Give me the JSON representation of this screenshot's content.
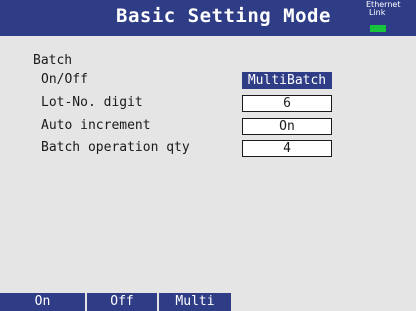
{
  "header": {
    "title": "Basic Setting Mode",
    "ethernet_label": "Ethernet",
    "link_label": "Link",
    "link_led_color": "#18c43c"
  },
  "section": {
    "title": "Batch"
  },
  "settings": [
    {
      "label": "On/Off",
      "value": "MultiBatch",
      "selected": true
    },
    {
      "label": "Lot-No. digit",
      "value": "6",
      "selected": false
    },
    {
      "label": "Auto increment",
      "value": "On",
      "selected": false
    },
    {
      "label": "Batch operation qty",
      "value": "4",
      "selected": false
    }
  ],
  "softkeys": [
    {
      "label": "On"
    },
    {
      "label": "Off"
    },
    {
      "label": "Multi"
    }
  ],
  "colors": {
    "title_bar": "#2f3d87",
    "background": "#e5e5e5",
    "selected_field": "#2f3d87"
  }
}
